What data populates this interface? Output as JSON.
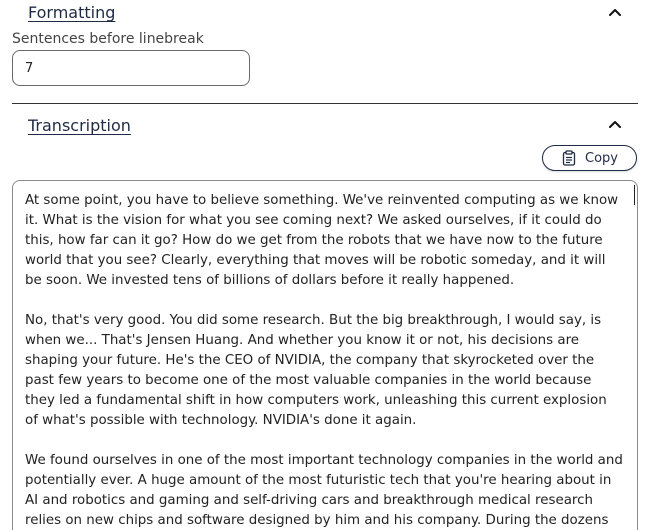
{
  "formatting": {
    "title": "Formatting",
    "field_label": "Sentences before linebreak",
    "field_value": "7"
  },
  "transcription": {
    "title": "Transcription",
    "copy_label": "Copy",
    "paragraphs": [
      "At some point, you have to believe something. We've reinvented computing as we know it. What is the vision for what you see coming next? We asked ourselves, if it could do this, how far can it go? How do we get from the robots that we have now to the future world that you see? Clearly, everything that moves will be robotic someday, and it will be soon. We invested tens of billions of dollars before it really happened.",
      " No, that's very good. You did some research. But the big breakthrough, I would say, is when we... That's Jensen Huang. And whether you know it or not, his decisions are shaping your future. He's the CEO of NVIDIA, the company that skyrocketed over the past few years to become one of the most valuable companies in the world because they led a fundamental shift in how computers work, unleashing this current explosion of what's possible with technology. NVIDIA's done it again.",
      " We found ourselves in one of the most important technology companies in the world and potentially ever. A huge amount of the most futuristic tech that you're hearing about in AI and robotics and gaming and self-driving cars and breakthrough medical research relies on new chips and software designed by him and his company. During the dozens of"
    ]
  },
  "colors": {
    "accent": "#1f2a44",
    "border": "#8a8a8a"
  }
}
